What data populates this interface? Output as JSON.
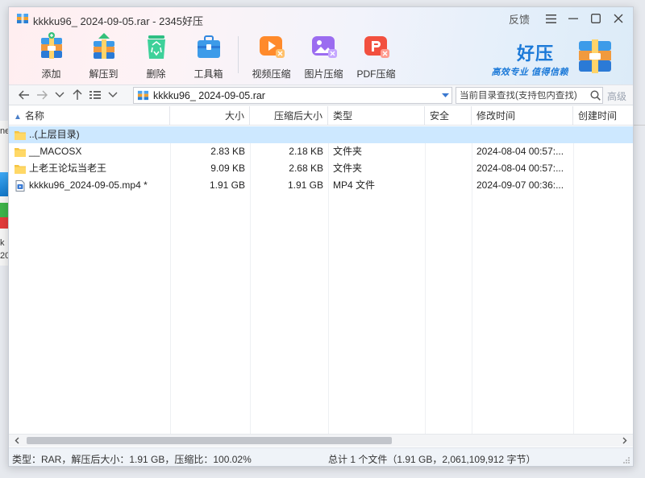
{
  "window": {
    "title": "kkkku96_ 2024-09-05.rar - 2345好压",
    "feedback_label": "反馈"
  },
  "toolbar": [
    {
      "id": "add",
      "label": "添加",
      "icon": "add-archive-icon"
    },
    {
      "id": "extract",
      "label": "解压到",
      "icon": "extract-to-icon"
    },
    {
      "id": "delete",
      "label": "删除",
      "icon": "delete-recycle-icon"
    },
    {
      "id": "tools",
      "label": "工具箱",
      "icon": "toolbox-icon"
    },
    {
      "id": "video",
      "label": "视频压缩",
      "icon": "video-compress-icon"
    },
    {
      "id": "image",
      "label": "图片压缩",
      "icon": "image-compress-icon"
    },
    {
      "id": "pdf",
      "label": "PDF压缩",
      "icon": "pdf-compress-icon"
    }
  ],
  "brand": {
    "name": "好压",
    "slogan": "高效专业  值得信赖",
    "accent_color": "#1b79d8"
  },
  "address": {
    "path": "kkkku96_ 2024-09-05.rar",
    "search_placeholder": "当前目录查找(支持包内查找)",
    "advanced_label": "高级"
  },
  "table": {
    "columns": [
      "名称",
      "大小",
      "压缩后大小",
      "类型",
      "安全",
      "修改时间",
      "创建时间"
    ],
    "rows": [
      {
        "name": "..(上层目录)",
        "size": "",
        "packed": "",
        "type": "",
        "security": "",
        "modified": "",
        "created": "",
        "icon": "folder-icon",
        "selected": true
      },
      {
        "name": "__MACOSX",
        "size": "2.83 KB",
        "packed": "2.18 KB",
        "type": "文件夹",
        "security": "",
        "modified": "2024-08-04 00:57:...",
        "created": "",
        "icon": "folder-icon",
        "selected": false
      },
      {
        "name": "上老王论坛当老王",
        "size": "9.09 KB",
        "packed": "2.68 KB",
        "type": "文件夹",
        "security": "",
        "modified": "2024-08-04 00:57:...",
        "created": "",
        "icon": "folder-icon",
        "selected": false
      },
      {
        "name": "kkkku96_2024-09-05.mp4 *",
        "size": "1.91 GB",
        "packed": "1.91 GB",
        "type": "MP4 文件",
        "security": "",
        "modified": "2024-09-07 00:36:...",
        "created": "",
        "icon": "video-file-icon",
        "selected": false
      }
    ]
  },
  "status": {
    "left": "类型：RAR，解压后大小：1.91 GB，压缩比：100.02%",
    "right": "总计 1 个文件（1.91 GB，2,061,109,912 字节）"
  },
  "background": {
    "left_text_1": "ne (",
    "left_text_2": "k",
    "left_text_3": "20"
  },
  "colors": {
    "selected_row": "#cde8ff",
    "folder": "#f5c542",
    "header_pink": "#ffeef0",
    "header_blue": "#dcebf8"
  }
}
